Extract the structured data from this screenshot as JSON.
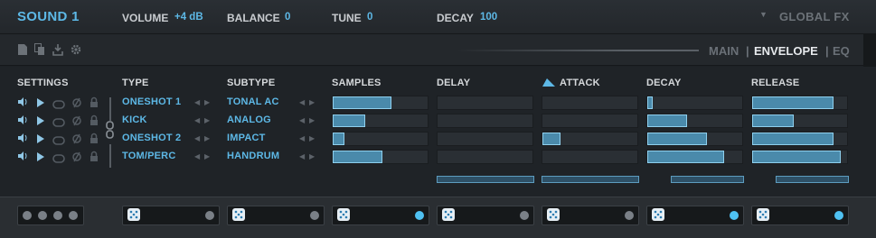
{
  "header": {
    "sound_title": "SOUND 1",
    "params": [
      {
        "label": "VOLUME",
        "value": "+4 dB"
      },
      {
        "label": "BALANCE",
        "value": "0"
      },
      {
        "label": "TUNE",
        "value": "0"
      },
      {
        "label": "DECAY",
        "value": "100"
      }
    ],
    "global_fx": "GLOBAL FX",
    "global_fx_arrow": "▼"
  },
  "toolbar": {
    "icons": [
      "new-file-icon",
      "copy-icon",
      "save-icon",
      "settings-icon"
    ],
    "tabs": [
      {
        "label": "MAIN",
        "active": false
      },
      {
        "label": "ENVELOPE",
        "active": true
      },
      {
        "label": "EQ",
        "active": false
      }
    ],
    "separator": "|"
  },
  "columns": {
    "settings": "SETTINGS",
    "type": "TYPE",
    "subtype": "SUBTYPE",
    "samples": "SAMPLES",
    "delay": "DELAY",
    "attack": "ATTACK",
    "decay": "DECAY",
    "release": "RELEASE"
  },
  "layers": [
    {
      "type": "ONESHOT 1",
      "subtype": "TONAL AC",
      "samples": 0.61,
      "attack": 0.0,
      "decay": 0.06,
      "release": 0.84
    },
    {
      "type": "KICK",
      "subtype": "ANALOG",
      "samples": 0.34,
      "attack": 0.0,
      "decay": 0.41,
      "release": 0.43
    },
    {
      "type": "ONESHOT 2",
      "subtype": "IMPACT",
      "samples": 0.12,
      "attack": 0.19,
      "decay": 0.62,
      "release": 0.84
    },
    {
      "type": "TOM/PERC",
      "subtype": "HANDRUM",
      "samples": 0.51,
      "attack": 0.0,
      "decay": 0.79,
      "release": 0.92
    }
  ],
  "colors": {
    "accent": "#5db8e6",
    "bar_fill": "#4a8aab",
    "bar_border": "#8fd0ee",
    "background": "#1f2327"
  },
  "bottom": {
    "dice_count": 7
  }
}
